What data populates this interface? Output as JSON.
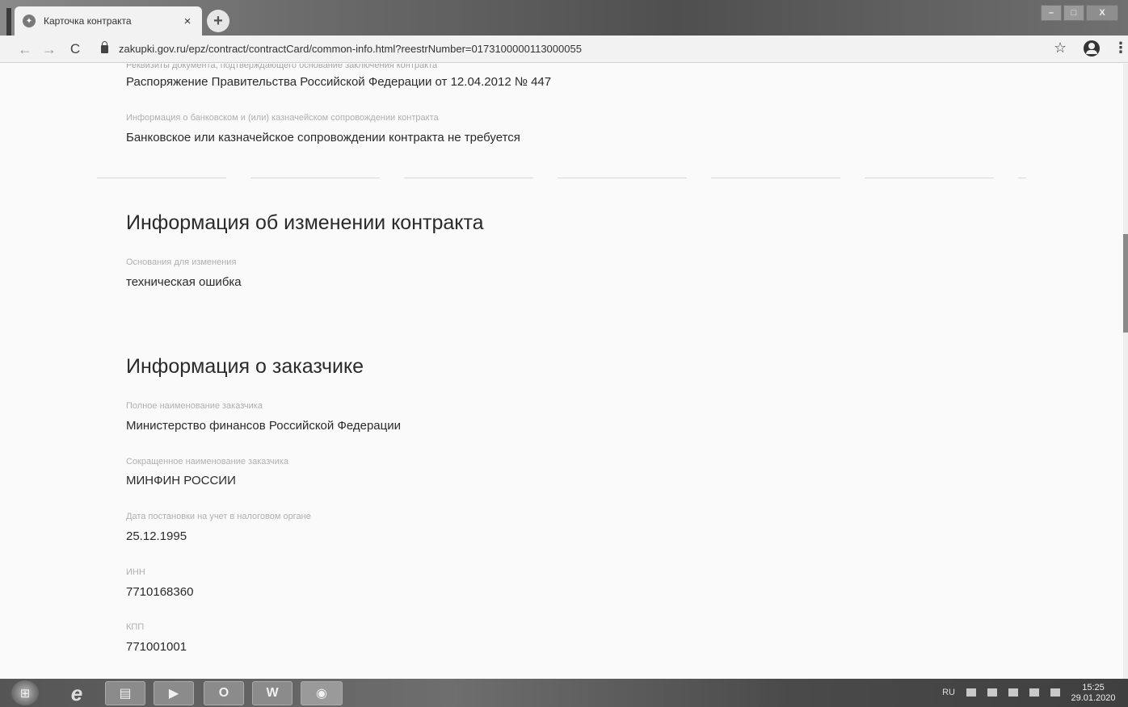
{
  "browser": {
    "tab_title": "Карточка контракта",
    "tab_close": "×",
    "new_tab": "+",
    "url": "zakupki.gov.ru/epz/contract/contractCard/common-info.html?reestrNumber=0173100000113000055",
    "window_controls": {
      "minimize": "–",
      "maximize": "□",
      "close": "X"
    },
    "nav": {
      "back": "←",
      "forward": "→",
      "reload": "C"
    },
    "star": "☆",
    "menu": "⋮"
  },
  "content": {
    "top_label_cut": "Реквизиты документа, подтверждающего основание заключения контракта",
    "doc_basis_value": "Распоряжение Правительства Российской Федерации от 12.04.2012 № 447",
    "bank_support_label": "Информация о банковском и (или) казначейском сопровождении контракта",
    "bank_support_value": "Банковское или казначейское сопровождении контракта не требуется",
    "change_section": {
      "title": "Информация об изменении контракта",
      "reason_label": "Основания для изменения",
      "reason_value": "техническая ошибка"
    },
    "customer_section": {
      "title": "Информация о заказчике",
      "full_name_label": "Полное наименование заказчика",
      "full_name_value": "Министерство финансов Российской Федерации",
      "short_name_label": "Сокращенное наименование заказчика",
      "short_name_value": "МИНФИН РОССИИ",
      "tax_date_label": "Дата постановки на учет в налоговом органе",
      "tax_date_value": "25.12.1995",
      "inn_label": "ИНН",
      "inn_value": "7710168360",
      "kpp_label": "КПП",
      "kpp_value": "771001001"
    }
  },
  "taskbar": {
    "language": "RU",
    "time": "15:25",
    "date": "29.01.2020",
    "apps": {
      "ie": "e",
      "outlook": "O",
      "word": "W",
      "media": "▶"
    }
  }
}
